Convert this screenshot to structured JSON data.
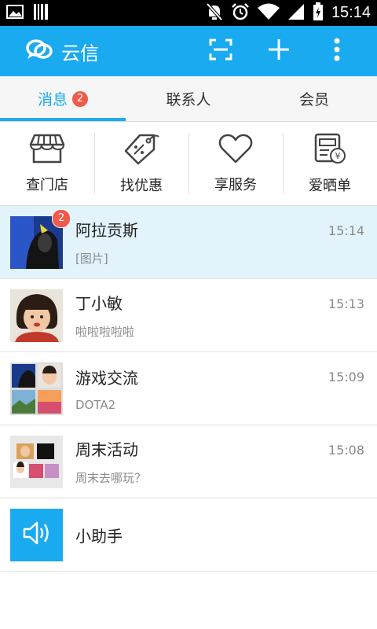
{
  "status": {
    "time": "15:14"
  },
  "app": {
    "title": "云信"
  },
  "tabs": [
    {
      "label": "消息",
      "badge": "2"
    },
    {
      "label": "联系人"
    },
    {
      "label": "会员"
    }
  ],
  "quick": [
    {
      "label": "查门店",
      "icon": "store-icon"
    },
    {
      "label": "找优惠",
      "icon": "coupon-icon"
    },
    {
      "label": "享服务",
      "icon": "heart-icon"
    },
    {
      "label": "爱晒单",
      "icon": "receipt-icon"
    }
  ],
  "conversations": [
    {
      "name": "阿拉贡斯",
      "preview": "[图片]",
      "time": "15:14",
      "badge": "2"
    },
    {
      "name": "丁小敏",
      "preview": "啦啦啦啦啦",
      "time": "15:13"
    },
    {
      "name": "游戏交流",
      "preview": "DOTA2",
      "time": "15:09"
    },
    {
      "name": "周末活动",
      "preview": "周末去哪玩？",
      "time": "15:08"
    },
    {
      "name": "小助手"
    }
  ],
  "colors": {
    "accent": "#1aaaf0",
    "badge": "#f15a4a",
    "selected_row": "#e2f3fc"
  }
}
